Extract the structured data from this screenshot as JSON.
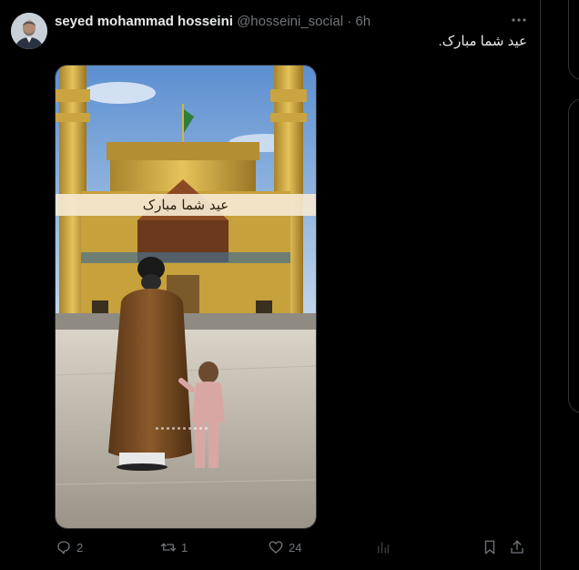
{
  "tweet": {
    "author_name": "seyed mohammad hosseini",
    "handle": "@hosseini_social",
    "separator": "·",
    "time": "6h",
    "text": "عید شما مبارک.",
    "media": {
      "banner_text": "عید شما مبارک"
    },
    "actions": {
      "replies": "2",
      "retweets": "1",
      "likes": "24"
    }
  },
  "icons": [
    "more-icon",
    "reply-icon",
    "retweet-icon",
    "like-icon",
    "views-icon",
    "bookmark-icon",
    "share-icon"
  ],
  "colors": {
    "background": "#000000",
    "text_primary": "#e7e9ea",
    "text_secondary": "#71767b",
    "border": "#2f3336"
  }
}
